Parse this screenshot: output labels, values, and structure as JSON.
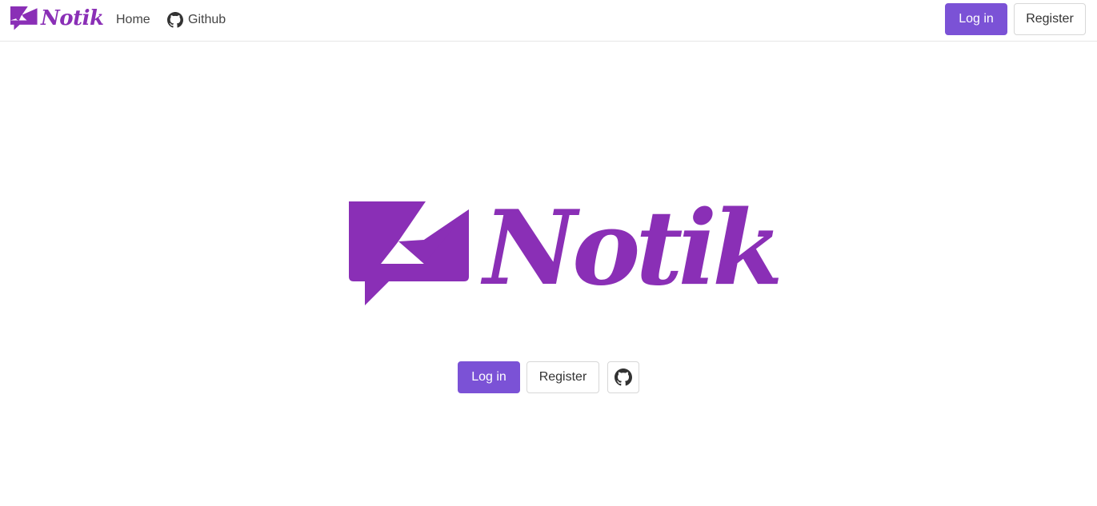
{
  "brand": {
    "name": "Notik",
    "color": "#8a2fb6"
  },
  "nav": {
    "home_label": "Home",
    "github_label": "Github",
    "login_label": "Log in",
    "register_label": "Register"
  },
  "hero": {
    "title": "Notik",
    "login_label": "Log in",
    "register_label": "Register",
    "github_icon": "github-icon"
  },
  "colors": {
    "primary": "#7b52d6",
    "brand": "#8a2fb6",
    "border": "#d7d7d7"
  }
}
